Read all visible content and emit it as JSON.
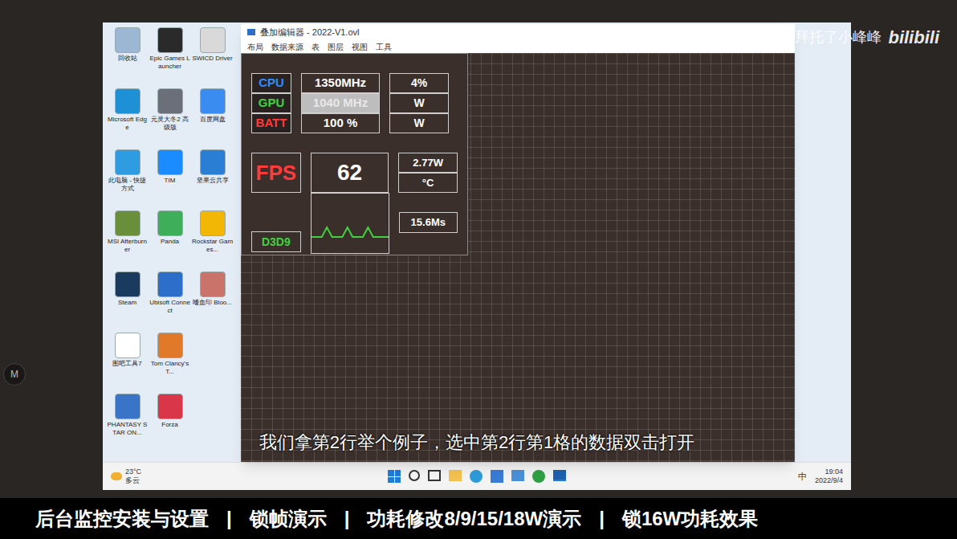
{
  "device": {
    "button_label": "M"
  },
  "watermark": {
    "channel": "拜托了小峰峰",
    "logo": "bilibili"
  },
  "desktop_icons": [
    [
      {
        "label": "回收站",
        "color": "#9bb7d4"
      },
      {
        "label": "Epic Games Launcher",
        "color": "#2a2a2a"
      },
      {
        "label": "SWICD Driver",
        "color": "#d9d9d9"
      }
    ],
    [
      {
        "label": "Microsoft Edge",
        "color": "#1e90d6"
      },
      {
        "label": "元灵大冬2 高级版",
        "color": "#6b6f7a"
      },
      {
        "label": "百度网盘",
        "color": "#3b8cf0"
      }
    ],
    [
      {
        "label": "此电脑 - 快捷方式",
        "color": "#2f9be0"
      },
      {
        "label": "TIM",
        "color": "#1a8cff"
      },
      {
        "label": "坚果云共享",
        "color": "#2a7fd4"
      }
    ],
    [
      {
        "label": "MSI Afterburner",
        "color": "#6a8f3a"
      },
      {
        "label": "Panda",
        "color": "#3fae5a"
      },
      {
        "label": "Rockstar Games...",
        "color": "#f2b705"
      }
    ],
    [
      {
        "label": "Steam",
        "color": "#1b3b5e"
      },
      {
        "label": "Ubisoft Connect",
        "color": "#2c6ec9"
      },
      {
        "label": "嗜血印 Bloo...",
        "color": "#c9736a"
      }
    ],
    [
      {
        "label": "图吧工具7",
        "color": "#ffffff"
      },
      {
        "label": "Tom Clancy's T...",
        "color": "#e07a2a"
      }
    ],
    [
      {
        "label": "PHANTASY STAR ON...",
        "color": "#3a74c8"
      },
      {
        "label": "Forza",
        "color": "#d9364a"
      }
    ]
  ],
  "window": {
    "title": "叠加编辑器 - 2022-V1.ovl"
  },
  "menu": [
    "布局",
    "数据来源",
    "表",
    "图层",
    "视图",
    "工具"
  ],
  "overlay": {
    "rows": [
      {
        "label": "CPU",
        "color": "#2f8cff",
        "value": "1350MHz",
        "extra": "4%",
        "selected": false
      },
      {
        "label": "GPU",
        "color": "#3fd23f",
        "value": "1040 MHz",
        "extra": "W",
        "selected": true
      },
      {
        "label": "BATT",
        "color": "#ff3b3b",
        "value": "100 %",
        "extra": "W",
        "selected": false
      }
    ],
    "fps": {
      "label": "FPS",
      "value": "62",
      "power": "2.77W",
      "temp": "°C"
    },
    "api": {
      "label": "D3D9",
      "frametime": "15.6Ms",
      "graph": [
        16,
        16,
        16,
        4,
        16,
        16,
        16,
        4,
        16,
        16,
        16,
        4,
        16,
        16,
        16,
        16
      ]
    }
  },
  "subtitle": "我们拿第2行举个例子，选中第2行第1格的数据双击打开",
  "taskbar": {
    "temperature": "23°C",
    "weather": "多云",
    "ime": "中",
    "time": "19:04",
    "date": "2022/9/4"
  },
  "chapters": [
    "后台监控安装与设置",
    "锁帧演示",
    "功耗修改8/9/15/18W演示",
    "锁16W功耗效果"
  ],
  "separator": "|"
}
